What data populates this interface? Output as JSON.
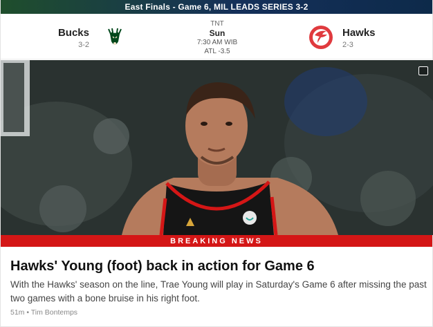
{
  "series": {
    "text": "East Finals - Game 6, MIL LEADS SERIES 3-2"
  },
  "home_team": {
    "name": "Bucks",
    "record": "3-2",
    "logo_icon": "bucks-deer-logo",
    "color": "#00471B"
  },
  "away_team": {
    "name": "Hawks",
    "record": "2-3",
    "logo_icon": "hawks-logo",
    "color": "#E03A3E"
  },
  "game": {
    "network": "TNT",
    "day": "Sun",
    "time": "7:30 AM WIB",
    "line": "ATL -3.5"
  },
  "story": {
    "banner": "BREAKING NEWS",
    "headline": "Hawks' Young (foot) back in action for Game 6",
    "summary": "With the Hawks' season on the line, Trae Young will play in Saturday's Game 6 after missing the past two games with a bone bruise in his right foot.",
    "meta": "51m • Tim Bontemps",
    "photo_icon": "image-gallery-icon"
  },
  "colors": {
    "breaking_red": "#D41616",
    "header_green": "#1F4E2C",
    "header_navy": "#15305A"
  }
}
